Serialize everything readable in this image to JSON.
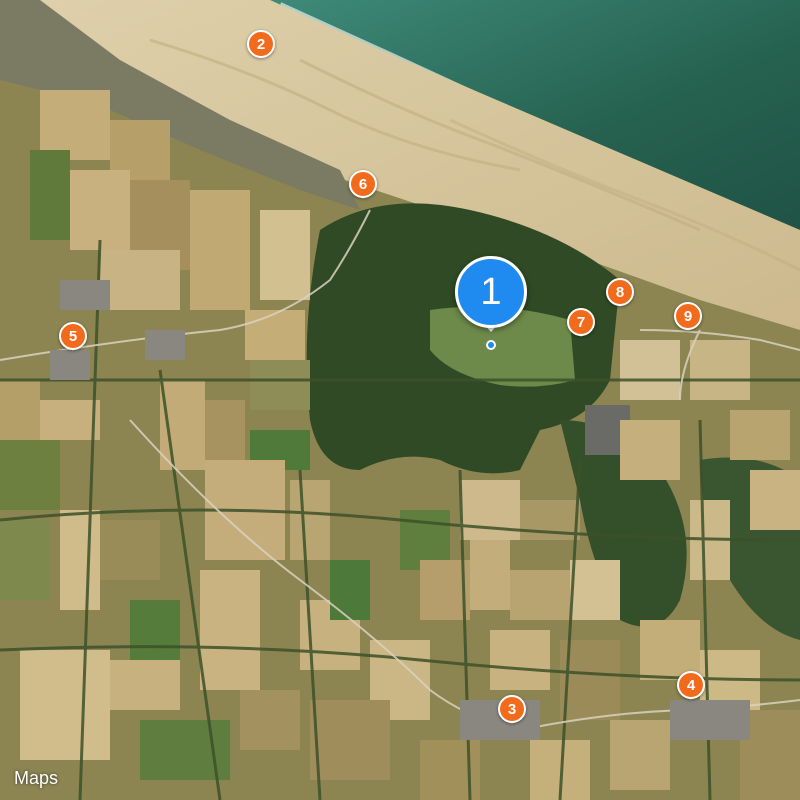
{
  "map": {
    "type": "satellite",
    "provider_icon": "apple-logo-icon",
    "attribution": "Maps",
    "colors": {
      "pin_primary": "#1f8bf0",
      "pin_secondary": "#f26a1b",
      "pin_border": "#ffffff"
    }
  },
  "pins": {
    "main": {
      "label": "1"
    },
    "p2": {
      "label": "2"
    },
    "p3": {
      "label": "3"
    },
    "p4": {
      "label": "4"
    },
    "p5": {
      "label": "5"
    },
    "p6": {
      "label": "6"
    },
    "p7": {
      "label": "7"
    },
    "p8": {
      "label": "8"
    },
    "p9": {
      "label": "9"
    }
  }
}
